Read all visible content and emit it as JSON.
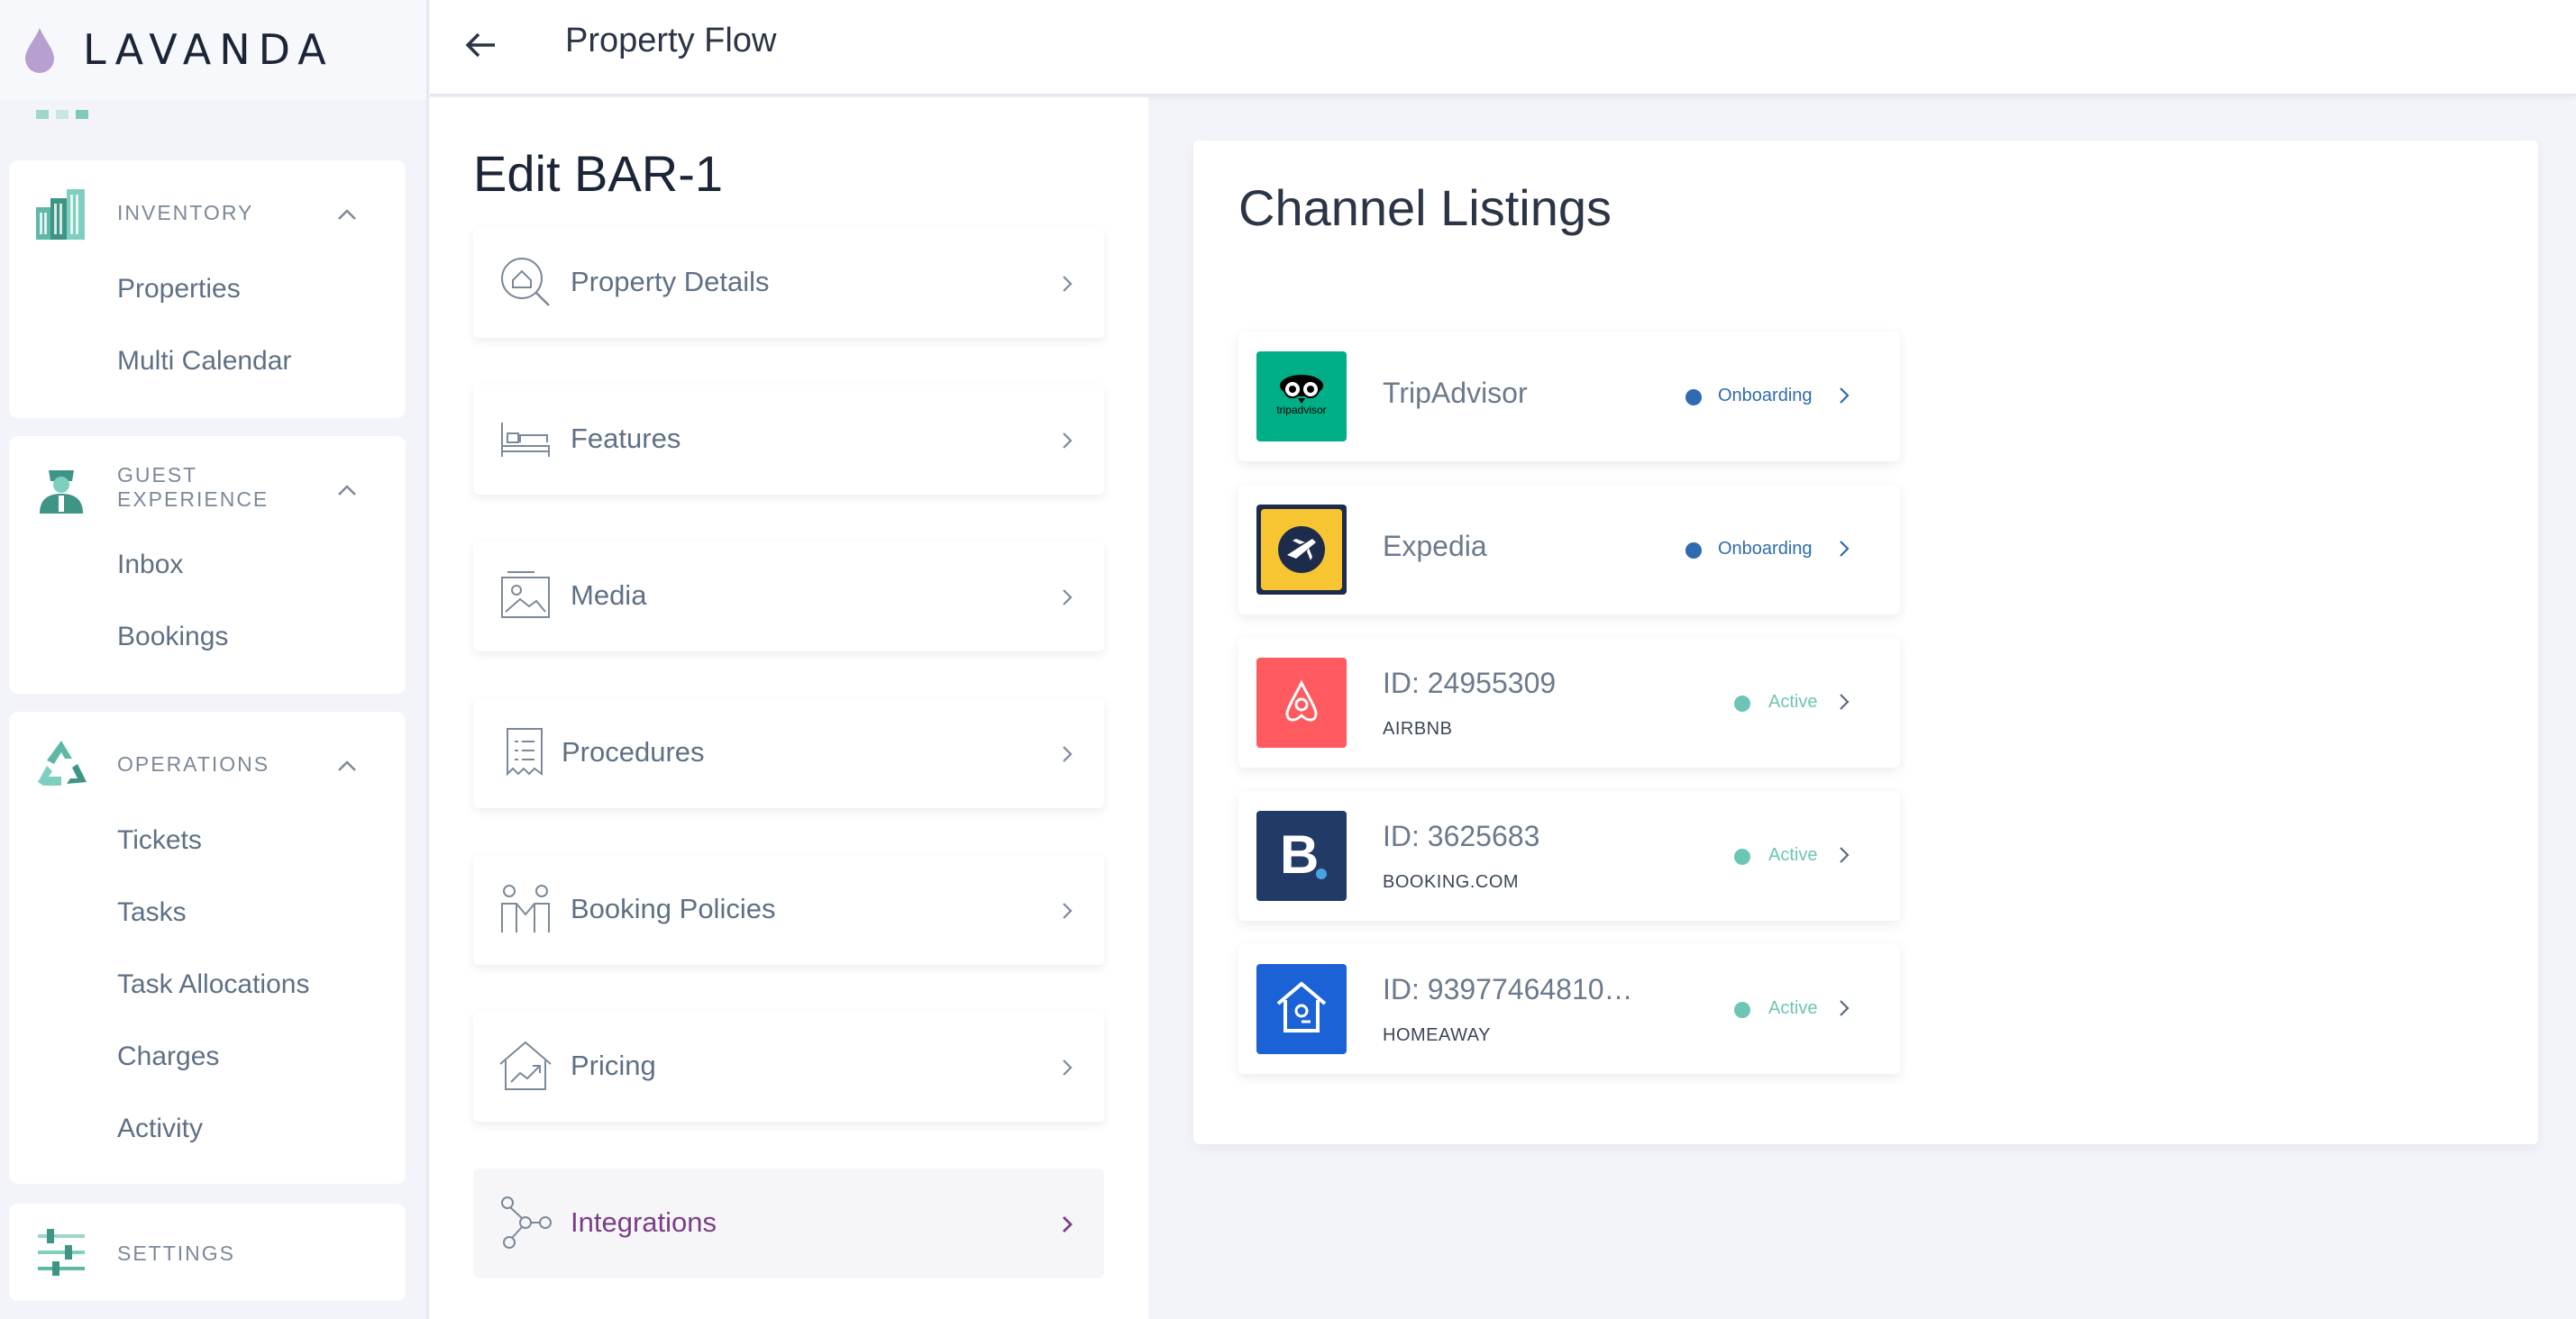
{
  "brand": {
    "name": "LAVANDA"
  },
  "sidebar": {
    "sections": [
      {
        "title": "INVENTORY",
        "icon": "buildings-icon",
        "items": [
          "Properties",
          "Multi Calendar"
        ]
      },
      {
        "title_lines": [
          "GUEST",
          "EXPERIENCE"
        ],
        "icon": "concierge-icon",
        "items": [
          "Inbox",
          "Bookings"
        ]
      },
      {
        "title": "OPERATIONS",
        "icon": "recycle-icon",
        "items": [
          "Tickets",
          "Tasks",
          "Task Allocations",
          "Charges",
          "Activity"
        ]
      },
      {
        "title": "SETTINGS",
        "icon": "sliders-icon",
        "items": []
      }
    ]
  },
  "topbar": {
    "title": "Property Flow"
  },
  "editor": {
    "title": "Edit BAR-1",
    "steps": [
      {
        "label": "Property Details",
        "icon": "house-search-icon"
      },
      {
        "label": "Features",
        "icon": "bed-icon"
      },
      {
        "label": "Media",
        "icon": "image-icon"
      },
      {
        "label": "Procedures",
        "icon": "document-icon"
      },
      {
        "label": "Booking Policies",
        "icon": "people-icon"
      },
      {
        "label": "Pricing",
        "icon": "house-chart-icon"
      },
      {
        "label": "Integrations",
        "icon": "nodes-icon",
        "active": true
      }
    ]
  },
  "channel_listings": {
    "title": "Channel Listings",
    "channels": [
      {
        "name": "TripAdvisor",
        "sub": "",
        "status": "Onboarding",
        "logo": "tripadvisor-logo",
        "logo_text": "tripadvisor"
      },
      {
        "name": "Expedia",
        "sub": "",
        "status": "Onboarding",
        "logo": "expedia-logo"
      },
      {
        "name": "ID: 24955309",
        "sub": "AIRBNB",
        "status": "Active",
        "logo": "airbnb-logo"
      },
      {
        "name": "ID: 3625683",
        "sub": "BOOKING.COM",
        "status": "Active",
        "logo": "booking-logo",
        "logo_text": "B"
      },
      {
        "name": "ID: 93977464810…",
        "sub": "HOMEAWAY",
        "status": "Active",
        "logo": "homeaway-logo"
      }
    ],
    "colors": {
      "onboarding": "#2f6bb0",
      "active": "#6cc6b3"
    }
  }
}
